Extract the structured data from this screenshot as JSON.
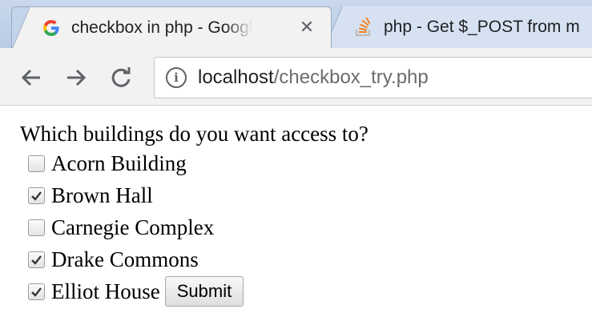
{
  "tabs": [
    {
      "title": "checkbox in php - Googl",
      "favicon": "google-g-icon",
      "active": true
    },
    {
      "title": "php - Get $_POST from m",
      "favicon": "stackoverflow-icon",
      "active": false
    }
  ],
  "toolbar": {
    "url_host": "localhost",
    "url_path": "/checkbox_try.php"
  },
  "form": {
    "question": "Which buildings do you want access to?",
    "options": [
      {
        "label": "Acorn Building",
        "checked": false
      },
      {
        "label": "Brown Hall",
        "checked": true
      },
      {
        "label": "Carnegie Complex",
        "checked": false
      },
      {
        "label": "Drake Commons",
        "checked": true
      },
      {
        "label": "Elliot House",
        "checked": true
      }
    ],
    "submit_label": "Submit"
  },
  "colors": {
    "tabstrip": "#c3d4ea",
    "toolbar": "#f2f2f2",
    "google_blue": "#4285f4",
    "stackoverflow_orange": "#f48024"
  }
}
